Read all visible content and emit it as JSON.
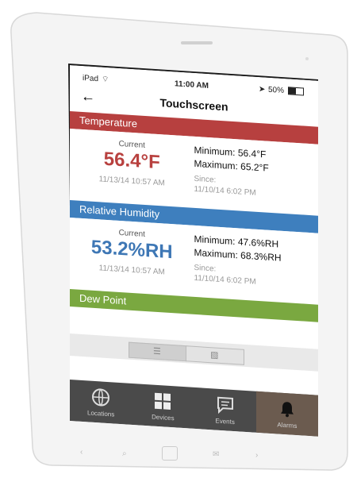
{
  "status_bar": {
    "carrier": "iPad",
    "time": "11:00 AM",
    "battery": "50%"
  },
  "nav": {
    "title": "Touchscreen"
  },
  "sections": [
    {
      "name": "Temperature",
      "color": "#b7403f",
      "current_label": "Current",
      "current_value": "56.4°F",
      "value_color": "#b8413f",
      "timestamp": "11/13/14 10:57 AM",
      "minimum": "Minimum: 56.4°F",
      "maximum": "Maximum: 65.2°F",
      "since_label": "Since:",
      "since_value": "11/10/14 6:02 PM"
    },
    {
      "name": "Relative Humidity",
      "color": "#3e7fbe",
      "current_label": "Current",
      "current_value": "53.2%RH",
      "value_color": "#3e77b5",
      "timestamp": "11/13/14 10:57 AM",
      "minimum": "Minimum: 47.6%RH",
      "maximum": "Maximum: 68.3%RH",
      "since_label": "Since:",
      "since_value": "11/10/14 6:02 PM"
    },
    {
      "name": "Dew Point",
      "color": "#7aa840"
    }
  ],
  "view_toggle": {
    "selected": "list"
  },
  "tabbar": [
    {
      "label": "Locations",
      "icon": "globe-icon"
    },
    {
      "label": "Devices",
      "icon": "grid-icon"
    },
    {
      "label": "Events",
      "icon": "chat-icon"
    },
    {
      "label": "Alarms",
      "icon": "bell-icon",
      "active": true
    }
  ],
  "colors": {
    "bezel": "#f5f5f5",
    "screen_bg": "#ffffff",
    "tabbar_bg": "#4a4a4a",
    "tabbar_active": "#6b5b4f"
  }
}
